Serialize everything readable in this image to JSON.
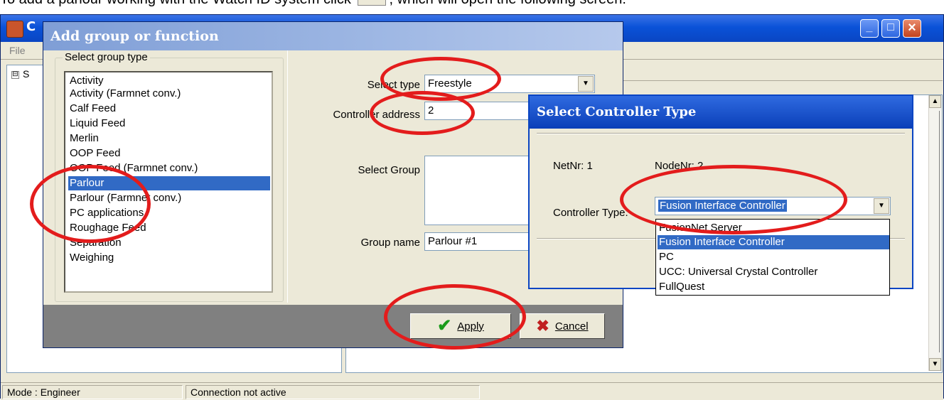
{
  "instruction": {
    "text_before": "To add a parlour working with the Watch ID system click",
    "text_after": ", which will open the following screen:"
  },
  "main_window": {
    "title_fragment": "C",
    "menu": {
      "file": "File"
    },
    "tree": {
      "toggle": "⊟",
      "root_label": "S"
    },
    "status": {
      "mode": "Mode : Engineer",
      "connection": "Connection not active"
    }
  },
  "add_dialog": {
    "title": "Add group or function",
    "group_type_legend": "Select group type",
    "group_types": [
      "Activity",
      "Activity (Farmnet conv.)",
      "Calf Feed",
      "Liquid Feed",
      "Merlin",
      "OOP Feed",
      "OOP Feed (Farmnet conv.)",
      "Parlour",
      "Parlour (Farmnet conv.)",
      "PC applications",
      "Roughage Feed",
      "Separation",
      "Weighing"
    ],
    "selected_group_type": "Parlour",
    "select_type_label": "Select type",
    "select_type_value": "Freestyle",
    "controller_address_label": "Controller address",
    "controller_address_value": "2",
    "select_group_label": "Select Group",
    "group_name_label": "Group name",
    "group_name_value": "Parlour #1",
    "apply_label": "Apply",
    "cancel_label": "Cancel"
  },
  "controller_dialog": {
    "title": "Select Controller Type",
    "net_nr": "NetNr: 1",
    "node_nr": "NodeNr: 2",
    "controller_type_label": "Controller Type:",
    "controller_type_value": "Fusion Interface Controller",
    "options": [
      "FusionNet Server",
      "Fusion Interface Controller",
      "PC",
      "UCC: Universal Crystal Controller",
      "FullQuest"
    ],
    "selected_option": "Fusion Interface Controller"
  },
  "colors": {
    "annotation_red": "#e31c1c",
    "selection_blue": "#316ac5",
    "xp_title_blue": "#0a52d8"
  }
}
